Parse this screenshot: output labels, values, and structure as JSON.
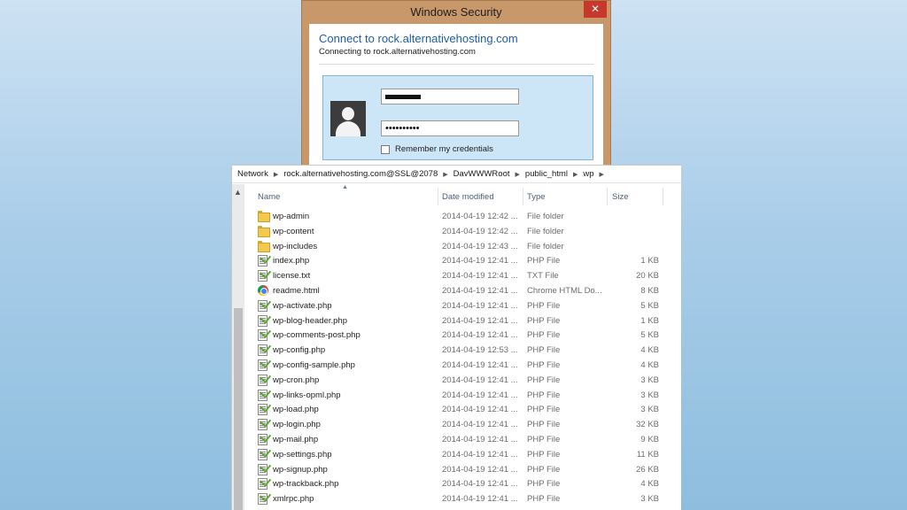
{
  "security_dialog": {
    "title": "Windows Security",
    "close_glyph": "✕",
    "heading": "Connect to rock.alternativehosting.com",
    "subheading": "Connecting to rock.alternativehosting.com",
    "password_mask": "••••••••••",
    "remember_label": "Remember my credentials",
    "remember_checked": false,
    "colors": {
      "frame": "#c8976a",
      "close": "#c7382b",
      "heading": "#1f5ea8",
      "cred_box": "#cde6f7"
    }
  },
  "explorer": {
    "breadcrumb": [
      "Network",
      "rock.alternativehosting.com@SSL@2078",
      "DavWWWRoot",
      "public_html",
      "wp"
    ],
    "columns": {
      "name": "Name",
      "date": "Date modified",
      "type": "Type",
      "size": "Size"
    },
    "files": [
      {
        "icon": "folder-icon",
        "name": "wp-admin",
        "date": "2014-04-19 12:42 ...",
        "type": "File folder",
        "size": ""
      },
      {
        "icon": "folder-icon",
        "name": "wp-content",
        "date": "2014-04-19 12:42 ...",
        "type": "File folder",
        "size": ""
      },
      {
        "icon": "folder-icon",
        "name": "wp-includes",
        "date": "2014-04-19 12:43 ...",
        "type": "File folder",
        "size": ""
      },
      {
        "icon": "php-file-icon",
        "name": "index.php",
        "date": "2014-04-19 12:41 ...",
        "type": "PHP File",
        "size": "1 KB"
      },
      {
        "icon": "text-file-icon",
        "name": "license.txt",
        "date": "2014-04-19 12:41 ...",
        "type": "TXT File",
        "size": "20 KB"
      },
      {
        "icon": "chrome-icon",
        "name": "readme.html",
        "date": "2014-04-19 12:41 ...",
        "type": "Chrome HTML Do...",
        "size": "8 KB"
      },
      {
        "icon": "php-file-icon",
        "name": "wp-activate.php",
        "date": "2014-04-19 12:41 ...",
        "type": "PHP File",
        "size": "5 KB"
      },
      {
        "icon": "php-file-icon",
        "name": "wp-blog-header.php",
        "date": "2014-04-19 12:41 ...",
        "type": "PHP File",
        "size": "1 KB"
      },
      {
        "icon": "php-file-icon",
        "name": "wp-comments-post.php",
        "date": "2014-04-19 12:41 ...",
        "type": "PHP File",
        "size": "5 KB"
      },
      {
        "icon": "php-file-icon",
        "name": "wp-config.php",
        "date": "2014-04-19 12:53 ...",
        "type": "PHP File",
        "size": "4 KB"
      },
      {
        "icon": "php-file-icon",
        "name": "wp-config-sample.php",
        "date": "2014-04-19 12:41 ...",
        "type": "PHP File",
        "size": "4 KB"
      },
      {
        "icon": "php-file-icon",
        "name": "wp-cron.php",
        "date": "2014-04-19 12:41 ...",
        "type": "PHP File",
        "size": "3 KB"
      },
      {
        "icon": "php-file-icon",
        "name": "wp-links-opml.php",
        "date": "2014-04-19 12:41 ...",
        "type": "PHP File",
        "size": "3 KB"
      },
      {
        "icon": "php-file-icon",
        "name": "wp-load.php",
        "date": "2014-04-19 12:41 ...",
        "type": "PHP File",
        "size": "3 KB"
      },
      {
        "icon": "php-file-icon",
        "name": "wp-login.php",
        "date": "2014-04-19 12:41 ...",
        "type": "PHP File",
        "size": "32 KB"
      },
      {
        "icon": "php-file-icon",
        "name": "wp-mail.php",
        "date": "2014-04-19 12:41 ...",
        "type": "PHP File",
        "size": "9 KB"
      },
      {
        "icon": "php-file-icon",
        "name": "wp-settings.php",
        "date": "2014-04-19 12:41 ...",
        "type": "PHP File",
        "size": "11 KB"
      },
      {
        "icon": "php-file-icon",
        "name": "wp-signup.php",
        "date": "2014-04-19 12:41 ...",
        "type": "PHP File",
        "size": "26 KB"
      },
      {
        "icon": "php-file-icon",
        "name": "wp-trackback.php",
        "date": "2014-04-19 12:41 ...",
        "type": "PHP File",
        "size": "4 KB"
      },
      {
        "icon": "php-file-icon",
        "name": "xmlrpc.php",
        "date": "2014-04-19 12:41 ...",
        "type": "PHP File",
        "size": "3 KB"
      }
    ]
  }
}
